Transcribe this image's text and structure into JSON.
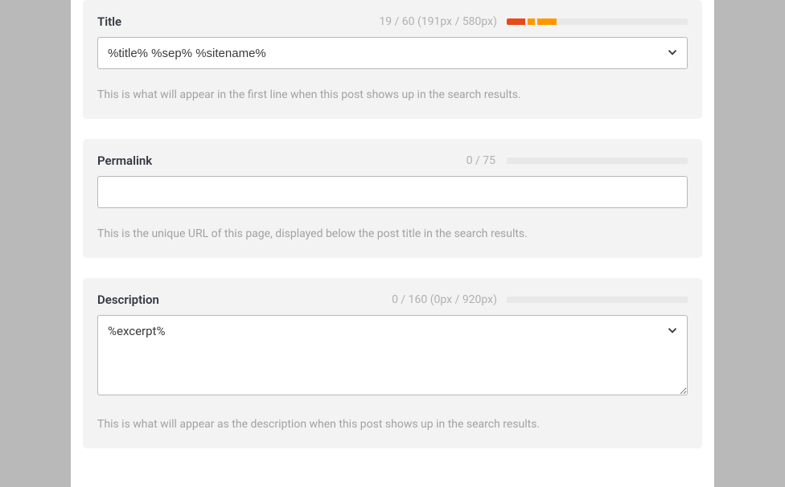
{
  "title": {
    "label": "Title",
    "counter": "19 / 60 (191px / 580px)",
    "value": "%title% %sep% %sitename%",
    "help": "This is what will appear in the first line when this post shows up in the search results.",
    "progress_segments": [
      {
        "width": "10%",
        "color": "#e64a19"
      },
      {
        "width": "4%",
        "color": "#ff9800"
      },
      {
        "width": "11%",
        "color": "#ff9800"
      }
    ]
  },
  "permalink": {
    "label": "Permalink",
    "counter": "0 / 75",
    "value": "",
    "help": "This is the unique URL of this page, displayed below the post title in the search results."
  },
  "description": {
    "label": "Description",
    "counter": "0 / 160 (0px / 920px)",
    "value": "%excerpt%",
    "help": "This is what will appear as the description when this post shows up in the search results."
  }
}
